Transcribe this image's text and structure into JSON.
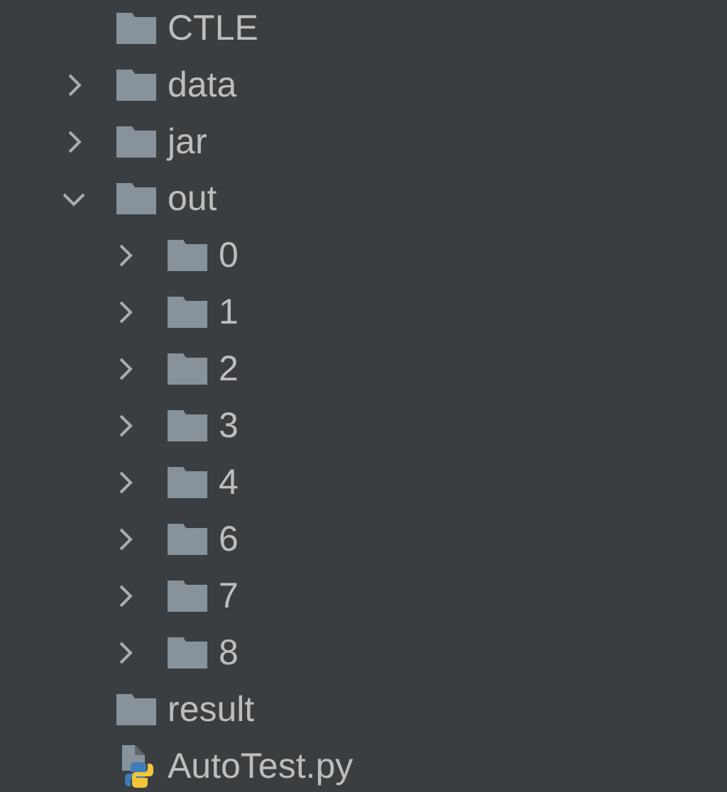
{
  "tree": [
    {
      "kind": "folder",
      "name": "CTLE"
    },
    {
      "kind": "folder",
      "name": "data",
      "expanded": false
    },
    {
      "kind": "folder",
      "name": "jar",
      "expanded": false
    },
    {
      "kind": "folder",
      "name": "out",
      "expanded": true,
      "children": [
        {
          "kind": "folder",
          "name": "0",
          "expanded": false
        },
        {
          "kind": "folder",
          "name": "1",
          "expanded": false
        },
        {
          "kind": "folder",
          "name": "2",
          "expanded": false
        },
        {
          "kind": "folder",
          "name": "3",
          "expanded": false
        },
        {
          "kind": "folder",
          "name": "4",
          "expanded": false
        },
        {
          "kind": "folder",
          "name": "6",
          "expanded": false
        },
        {
          "kind": "folder",
          "name": "7",
          "expanded": false
        },
        {
          "kind": "folder",
          "name": "8",
          "expanded": false
        }
      ]
    },
    {
      "kind": "folder",
      "name": "result"
    },
    {
      "kind": "python-file",
      "name": "AutoTest.py"
    }
  ]
}
